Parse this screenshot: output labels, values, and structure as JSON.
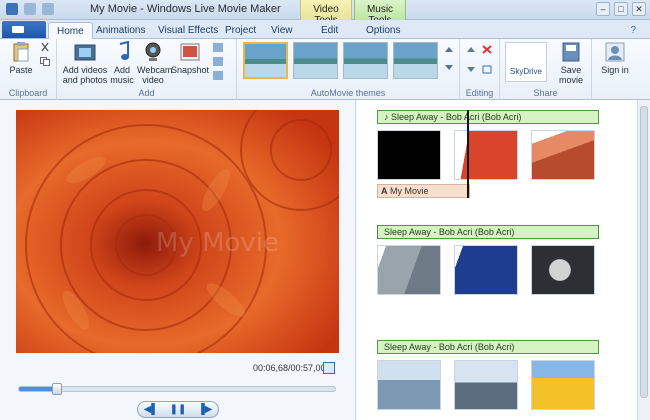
{
  "window": {
    "title": "My Movie - Windows Live Movie Maker",
    "context_tabs": {
      "video_tools": "Video Tools",
      "music_tools": "Music Tools"
    }
  },
  "tabs": [
    {
      "label": "Home",
      "active": true
    },
    {
      "label": "Animations"
    },
    {
      "label": "Visual Effects"
    },
    {
      "label": "Project"
    },
    {
      "label": "View"
    },
    {
      "label": "Edit"
    },
    {
      "label": "Options"
    }
  ],
  "ribbon": {
    "clipboard": {
      "label": "Clipboard",
      "paste": "Paste"
    },
    "add": {
      "label": "Add",
      "add_videos": "Add videos and photos",
      "add_music": "Add music",
      "webcam_video": "Webcam video",
      "snapshot": "Snapshot"
    },
    "themes": {
      "label": "AutoMovie themes"
    },
    "editing": {
      "label": "Editing"
    },
    "share": {
      "label": "Share",
      "skydrive": "SkyDrive",
      "save_movie": "Save movie"
    },
    "sign_in": "Sign in"
  },
  "preview": {
    "watermark": "My Movie",
    "timecode": "00:06,68/00:57,00",
    "progress": 0.12
  },
  "storyboard": {
    "music_label": "Sleep Away - Bob Acri (Bob Acri)",
    "caption": "My Movie"
  },
  "colors": {
    "accent": "#2f6db5",
    "video_tools": "#efe99f",
    "music_tools": "#c9ecb1",
    "music_bar": "#d4f2c2"
  }
}
